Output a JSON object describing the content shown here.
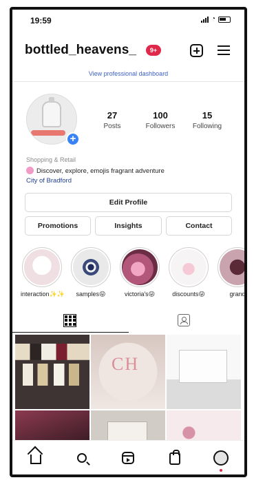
{
  "status_bar": {
    "time": "19:59"
  },
  "header": {
    "username": "bottled_heavens_",
    "notification_count": "9+"
  },
  "dashboard_link": "View professional dashboard",
  "stats": [
    {
      "value": "27",
      "label": "Posts"
    },
    {
      "value": "100",
      "label": "Followers"
    },
    {
      "value": "15",
      "label": "Following"
    }
  ],
  "profile": {
    "category": "Shopping & Retail",
    "bio": "Discover, explore, emojis fragrant adventure",
    "location": "City of Bradford"
  },
  "buttons": {
    "edit_profile": "Edit Profile",
    "promotions": "Promotions",
    "insights": "Insights",
    "contact": "Contact"
  },
  "highlights": [
    {
      "label": "interaction✨✨"
    },
    {
      "label": "samples😜"
    },
    {
      "label": "victoria's😜"
    },
    {
      "label": "discounts😜"
    },
    {
      "label": "grand"
    }
  ],
  "tabs": [
    {
      "icon": "grid-icon"
    },
    {
      "icon": "tagged-icon"
    }
  ],
  "posts": [
    {
      "description": "sample vials",
      "colors": [
        "#4a3a3a",
        "#d7c7b6"
      ]
    },
    {
      "description": "CH perfume box",
      "colors": [
        "#e8dfd9",
        "#d99a9a"
      ]
    },
    {
      "description": "Dior perfume box",
      "colors": [
        "#f4f4f4",
        "#cfcfcf"
      ]
    },
    {
      "description": "perfume",
      "colors": [
        "#7a2c3f",
        "#2b1b1e"
      ]
    },
    {
      "description": "perfume box",
      "colors": [
        "#c7c2bb",
        "#8e7a66"
      ]
    },
    {
      "description": "floral box",
      "colors": [
        "#f3e1e4",
        "#c2879b"
      ]
    }
  ],
  "bottom_nav": [
    {
      "icon": "home-icon"
    },
    {
      "icon": "search-icon"
    },
    {
      "icon": "reels-icon"
    },
    {
      "icon": "shop-icon"
    },
    {
      "icon": "profile-icon"
    }
  ],
  "colors": {
    "accent_blue": "#3a82f7",
    "badge_red": "#e0294a",
    "link_blue": "#1f3f8f"
  }
}
